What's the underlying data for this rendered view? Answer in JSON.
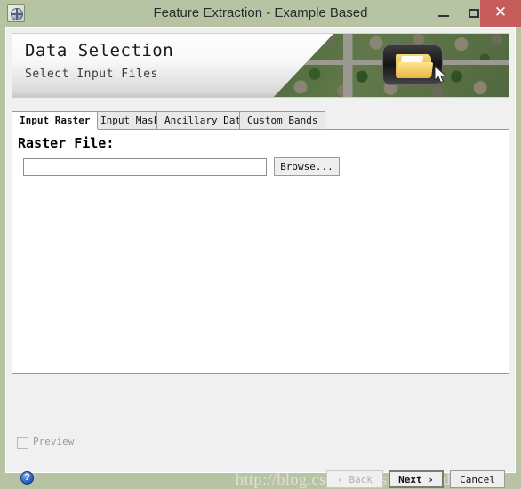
{
  "window": {
    "title": "Feature Extraction - Example Based",
    "app_icon": "envi-globe-icon",
    "controls": {
      "minimize": "–",
      "maximize": "□",
      "close": "✕"
    },
    "titlebar_color": "#b7c4a4",
    "close_color": "#c75c5c"
  },
  "banner": {
    "title": "Data Selection",
    "subtitle": "Select Input Files",
    "image_alt": "aerial-photo-suburban-neighborhood",
    "overlay_icon": "open-folder-icon",
    "cursor": "mouse-pointer-icon"
  },
  "tabs": [
    {
      "label": "Input Raster",
      "active": true
    },
    {
      "label": "Input Mask",
      "active": false
    },
    {
      "label": "Ancillary Data",
      "active": false
    },
    {
      "label": "Custom Bands",
      "active": false
    }
  ],
  "panel": {
    "raster_file_label": "Raster File:",
    "raster_file_value": "",
    "raster_file_placeholder": "",
    "browse_label": "Browse..."
  },
  "footer": {
    "preview_label": "Preview",
    "preview_checked": false,
    "help_glyph": "?",
    "back_label": "‹ Back",
    "next_label": "Next ›",
    "cancel_label": "Cancel"
  },
  "watermark": {
    "text": "http://blog.csdn.net/esrichinacd"
  }
}
